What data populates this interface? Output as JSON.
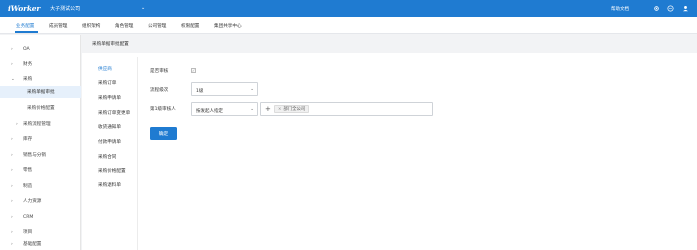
{
  "header": {
    "logo": "iWorker",
    "company": "大子测试公司",
    "company_caret": "⌄",
    "help_label": "帮助文档",
    "icons": [
      "gear-icon",
      "chat-icon",
      "user-icon"
    ]
  },
  "menu": {
    "items": [
      {
        "label": "业务配置",
        "active": true
      },
      {
        "label": "成员管理",
        "active": false
      },
      {
        "label": "组织架构",
        "active": false
      },
      {
        "label": "角色管理",
        "active": false
      },
      {
        "label": "公司管理",
        "active": false
      },
      {
        "label": "权限配置",
        "active": false
      },
      {
        "label": "集团共享中心",
        "active": false
      }
    ]
  },
  "sidebar": {
    "items": [
      {
        "label": "OA",
        "arrow": "›"
      },
      {
        "label": "财务",
        "arrow": "›"
      },
      {
        "label": "采购",
        "arrow": "⌄"
      },
      {
        "label": "采购单据审批",
        "arrow": ""
      },
      {
        "label": "采购价格配置",
        "arrow": ""
      },
      {
        "label": "采购流程管理",
        "arrow": "›"
      },
      {
        "label": "库存",
        "arrow": "›"
      },
      {
        "label": "销售与分销",
        "arrow": "›"
      },
      {
        "label": "零售",
        "arrow": "›"
      },
      {
        "label": "制造",
        "arrow": "›"
      },
      {
        "label": "人力资源",
        "arrow": "›"
      },
      {
        "label": "CRM",
        "arrow": "›"
      },
      {
        "label": "项目",
        "arrow": "›"
      },
      {
        "label": "基础配置",
        "arrow": "›"
      }
    ]
  },
  "page_tab": "采购单据审批配置",
  "subnav": {
    "items": [
      {
        "label": "供应商",
        "active": true
      },
      {
        "label": "采购订单",
        "active": false
      },
      {
        "label": "采购申请单",
        "active": false
      },
      {
        "label": "采购订单变更单",
        "active": false
      },
      {
        "label": "收货通知单",
        "active": false
      },
      {
        "label": "付款申请单",
        "active": false
      },
      {
        "label": "采购合同",
        "active": false
      },
      {
        "label": "采购价格配置",
        "active": false
      },
      {
        "label": "采购退料单",
        "active": false
      }
    ]
  },
  "form": {
    "need_approval_label": "是否审核",
    "need_approval_checked": false,
    "level_label": "流程级次",
    "level_value": "1级",
    "approver_label": "第1级审核人",
    "approver_type_value": "按发起人指定",
    "approver_tag": "部门全公司",
    "confirm_label": "确定"
  }
}
